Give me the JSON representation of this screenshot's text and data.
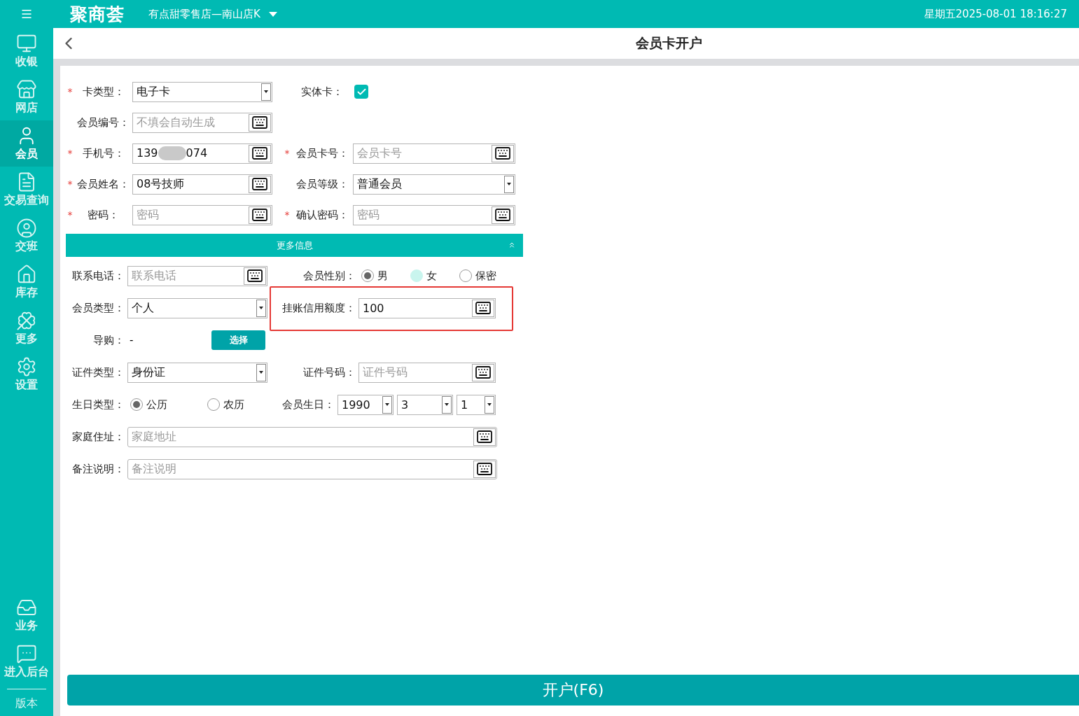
{
  "header": {
    "logo": "聚商荟",
    "store": "有点甜零售店—南山店K",
    "datetime": "星期五2025-08-01 18:16:27"
  },
  "sidebar": {
    "items": [
      {
        "label": "收银",
        "selected": false
      },
      {
        "label": "网店",
        "selected": false
      },
      {
        "label": "会员",
        "selected": true
      },
      {
        "label": "交易查询",
        "selected": false
      },
      {
        "label": "交班",
        "selected": false
      },
      {
        "label": "库存",
        "selected": false
      },
      {
        "label": "更多",
        "selected": false
      },
      {
        "label": "设置",
        "selected": false
      }
    ],
    "bottom_items": [
      {
        "label": "业务"
      },
      {
        "label": "进入后台"
      }
    ],
    "version_label": "版本"
  },
  "page": {
    "title": "会员卡开户"
  },
  "form": {
    "rows": [
      [
        {
          "kind": "select",
          "mark": "*",
          "label": "卡类型：",
          "value": "电子卡"
        },
        {
          "kind": "checkbox",
          "label": "实体卡：",
          "checked": true
        }
      ],
      [
        {
          "kind": "input",
          "label": "会员编号：",
          "placeholder": "不填会自动生成"
        }
      ],
      [
        {
          "kind": "masked",
          "mark": "*",
          "label": "手机号：",
          "value_start": "139",
          "value_end": "074"
        },
        {
          "kind": "input",
          "mark": "*",
          "label": "会员卡号：",
          "placeholder": "会员卡号"
        }
      ],
      [
        {
          "kind": "input",
          "mark": "*",
          "label": "会员姓名：",
          "value": "08号技师"
        },
        {
          "kind": "select",
          "label": "会员等级：",
          "value": "普通会员"
        }
      ],
      [
        {
          "kind": "input",
          "mark": "*",
          "label": "密码：",
          "placeholder": "密码"
        },
        {
          "kind": "input",
          "mark": "*",
          "label": "确认密码：",
          "placeholder": "密码"
        }
      ]
    ]
  },
  "more": {
    "title": "更多信息",
    "expanded": true,
    "rows": [
      [
        {
          "kind": "input",
          "label": "联系电话：",
          "placeholder": "联系电话"
        },
        {
          "kind": "radio",
          "label": "会员性别：",
          "options": [
            {
              "label": "男",
              "selected": true,
              "hovered": false
            },
            {
              "label": "女",
              "selected": false,
              "hovered": true
            },
            {
              "label": "保密",
              "selected": false,
              "hovered": false
            }
          ]
        }
      ],
      [
        {
          "kind": "select",
          "label": "会员类型：",
          "value": "个人"
        },
        {
          "kind": "input",
          "label": "挂账信用额度：",
          "value": "100",
          "highlighted": true
        }
      ],
      [
        {
          "kind": "picker",
          "label": "导购：",
          "value": "-",
          "button": "选择"
        }
      ],
      [
        {
          "kind": "select",
          "label": "证件类型：",
          "value": "身份证"
        },
        {
          "kind": "input",
          "label": "证件号码：",
          "placeholder": "证件号码"
        }
      ],
      [
        {
          "kind": "radio",
          "label": "生日类型：",
          "options": [
            {
              "label": "公历",
              "selected": true,
              "hovered": false
            },
            {
              "label": "农历",
              "selected": false,
              "hovered": false
            }
          ]
        },
        {
          "kind": "date",
          "label": "会员生日：",
          "parts": [
            "1990",
            "3",
            "1"
          ]
        }
      ],
      [
        {
          "kind": "wide",
          "label": "家庭住址：",
          "placeholder": "家庭地址"
        }
      ],
      [
        {
          "kind": "wide",
          "label": "备注说明：",
          "placeholder": "备注说明"
        }
      ]
    ]
  },
  "submit": {
    "label": "开户(F6)"
  }
}
